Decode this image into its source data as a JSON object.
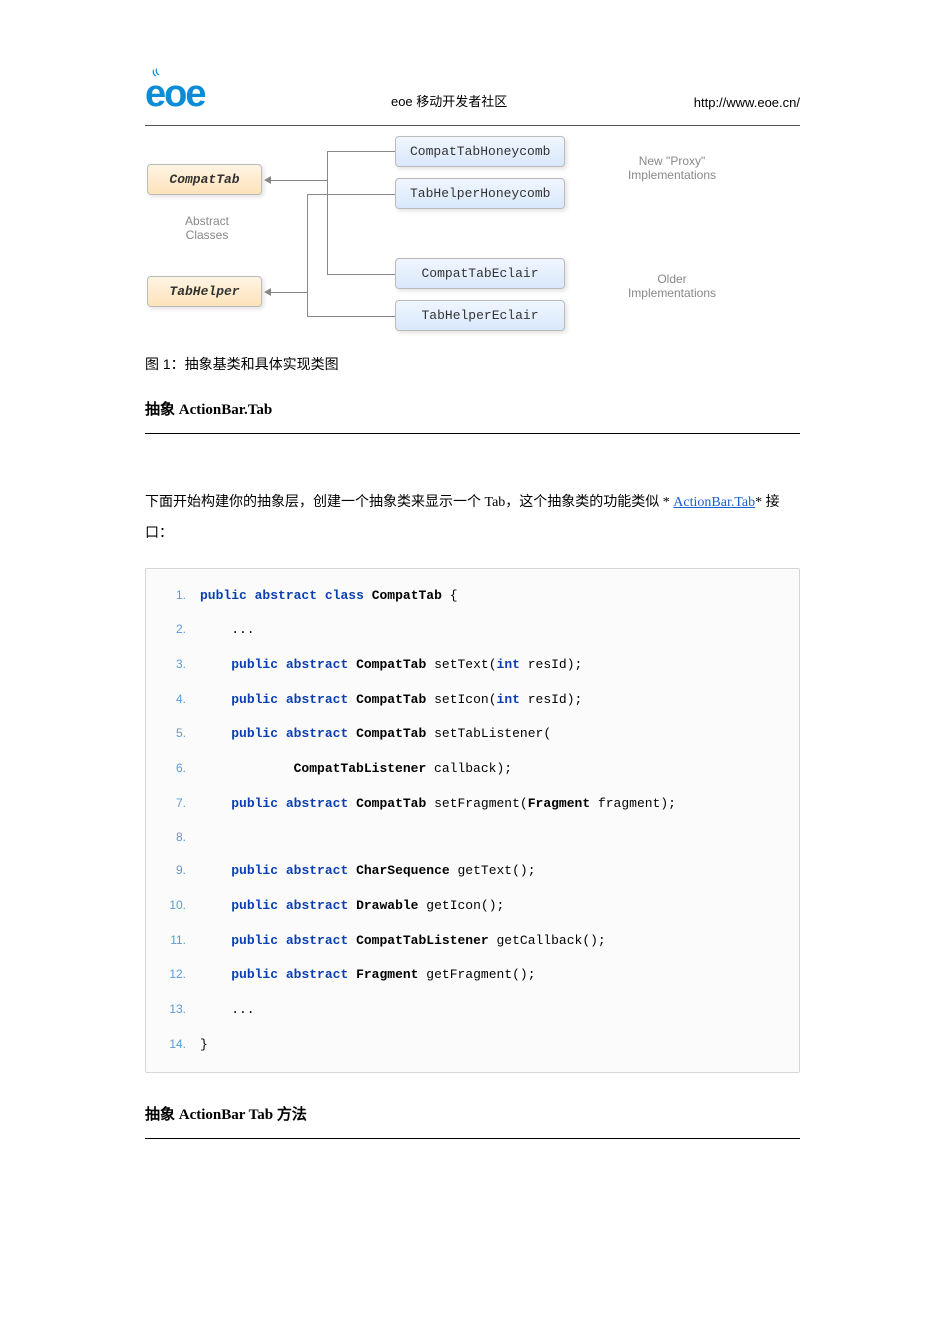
{
  "header": {
    "logo_text": "eoe",
    "center": "eoe 移动开发者社区",
    "right": "http://www.eoe.cn/"
  },
  "diagram": {
    "compat_tab": "CompatTab",
    "tab_helper": "TabHelper",
    "abstract_label_line1": "Abstract",
    "abstract_label_line2": "Classes",
    "compat_tab_honeycomb": "CompatTabHoneycomb",
    "tab_helper_honeycomb": "TabHelperHoneycomb",
    "compat_tab_eclair": "CompatTabEclair",
    "tab_helper_eclair": "TabHelperEclair",
    "new_label_line1": "New \"Proxy\"",
    "new_label_line2": "Implementations",
    "older_label_line1": "Older",
    "older_label_line2": "Implementations"
  },
  "figcap": "图 1：抽象基类和具体实现类图",
  "section1_title": "抽象 ActionBar.Tab",
  "para_pre": "下面开始构建你的抽象层，创建一个抽象类来显示一个 Tab，这个抽象类的功能类似 * ",
  "para_link": "ActionBar.Tab",
  "para_post": "* 接口：",
  "code": {
    "lines": [
      {
        "n": "1.",
        "html": "<span class='kw'>public</span> <span class='kw'>abstract</span> <span class='kw'>class</span> <span class='cls'>CompatTab</span> {"
      },
      {
        "n": "2.",
        "html": "    ..."
      },
      {
        "n": "3.",
        "html": "    <span class='kw'>public</span> <span class='kw'>abstract</span> <span class='cls'>CompatTab</span> setText(<span class='kw'>int</span> resId);"
      },
      {
        "n": "4.",
        "html": "    <span class='kw'>public</span> <span class='kw'>abstract</span> <span class='cls'>CompatTab</span> setIcon(<span class='kw'>int</span> resId);"
      },
      {
        "n": "5.",
        "html": "    <span class='kw'>public</span> <span class='kw'>abstract</span> <span class='cls'>CompatTab</span> setTabListener("
      },
      {
        "n": "6.",
        "html": "            <span class='cls'>CompatTabListener</span> callback);"
      },
      {
        "n": "7.",
        "html": "    <span class='kw'>public</span> <span class='kw'>abstract</span> <span class='cls'>CompatTab</span> setFragment(<span class='cls'>Fragment</span> fragment);"
      },
      {
        "n": "8.",
        "html": ""
      },
      {
        "n": "9.",
        "html": "    <span class='kw'>public</span> <span class='kw'>abstract</span> <span class='cls'>CharSequence</span> getText();"
      },
      {
        "n": "10.",
        "html": "    <span class='kw'>public</span> <span class='kw'>abstract</span> <span class='cls'>Drawable</span> getIcon();"
      },
      {
        "n": "11.",
        "html": "    <span class='kw'>public</span> <span class='kw'>abstract</span> <span class='cls'>CompatTabListener</span> getCallback();"
      },
      {
        "n": "12.",
        "html": "    <span class='kw'>public</span> <span class='kw'>abstract</span> <span class='cls'>Fragment</span> getFragment();"
      },
      {
        "n": "13.",
        "html": "    ..."
      },
      {
        "n": "14.",
        "html": "}"
      }
    ]
  },
  "section2_title": "抽象 ActionBar Tab 方法"
}
